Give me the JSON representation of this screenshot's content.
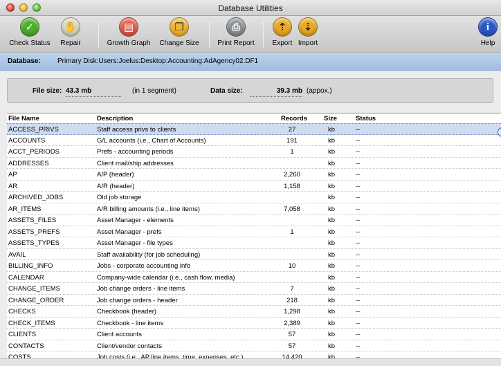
{
  "window": {
    "title": "Database Utilities"
  },
  "toolbar": {
    "buttons": [
      {
        "label": "Check Status",
        "icon": "check-icon",
        "color": "#4cae2a"
      },
      {
        "label": "Repair",
        "icon": "hand-icon",
        "color": "#c9c9b1"
      },
      {
        "label": "Growth Graph",
        "icon": "graph-icon",
        "color": "#e05a48"
      },
      {
        "label": "Change Size",
        "icon": "copy-pages-icon",
        "color": "#f0b52c"
      },
      {
        "label": "Print Report",
        "icon": "printer-icon",
        "color": "#8b9096"
      },
      {
        "label": "Export",
        "icon": "export-icon",
        "color": "#e8a820"
      },
      {
        "label": "Import",
        "icon": "import-icon",
        "color": "#e8a820"
      },
      {
        "label": "Help",
        "icon": "info-icon",
        "color": "#2a56c8"
      }
    ]
  },
  "database": {
    "label": "Database:",
    "path": "Primary Disk:Users:Joelus:Desktop:Accounting:AdAgency02.DF1"
  },
  "sizes": {
    "file_size_label": "File size:",
    "file_size_value": "43.3 mb",
    "segments": "(in 1 segment)",
    "data_size_label": "Data size:",
    "data_size_value": "39.3 mb",
    "approx": "(appox.)"
  },
  "table": {
    "headers": [
      "File Name",
      "Description",
      "Records",
      "Size",
      "Status"
    ],
    "selected_row": 0,
    "rows": [
      {
        "name": "ACCESS_PRIVS",
        "desc": "Staff access privs to clients",
        "records": "27",
        "size": "kb",
        "status": "--"
      },
      {
        "name": "ACCOUNTS",
        "desc": "G/L accounts (i.e., Chart of Accounts)",
        "records": "191",
        "size": "kb",
        "status": "--"
      },
      {
        "name": "ACCT_PERIODS",
        "desc": "Prefs - accounting periods",
        "records": "1",
        "size": "kb",
        "status": "--"
      },
      {
        "name": "ADDRESSES",
        "desc": "Client mail/ship addresses",
        "records": "",
        "size": "kb",
        "status": "--"
      },
      {
        "name": "AP",
        "desc": "A/P (header)",
        "records": "2,260",
        "size": "kb",
        "status": "--"
      },
      {
        "name": "AR",
        "desc": "A/R (header)",
        "records": "1,158",
        "size": "kb",
        "status": "--"
      },
      {
        "name": "ARCHIVED_JOBS",
        "desc": "Old job storage",
        "records": "",
        "size": "kb",
        "status": "--"
      },
      {
        "name": "AR_ITEMS",
        "desc": "A/R billing amounts (i.e., line items)",
        "records": "7,058",
        "size": "kb",
        "status": "--"
      },
      {
        "name": "ASSETS_FILES",
        "desc": "Asset Manager - elements",
        "records": "",
        "size": "kb",
        "status": "--"
      },
      {
        "name": "ASSETS_PREFS",
        "desc": "Asset Manager - prefs",
        "records": "1",
        "size": "kb",
        "status": "--"
      },
      {
        "name": "ASSETS_TYPES",
        "desc": "Asset Manager - file types",
        "records": "",
        "size": "kb",
        "status": "--"
      },
      {
        "name": "AVAIL",
        "desc": "Staff availability (for job scheduling)",
        "records": "",
        "size": "kb",
        "status": "--"
      },
      {
        "name": "BILLING_INFO",
        "desc": "Jobs - corporate accounting info",
        "records": "10",
        "size": "kb",
        "status": "--"
      },
      {
        "name": "CALENDAR",
        "desc": "Company-wide calendar (i.e., cash flow, media)",
        "records": "",
        "size": "kb",
        "status": "--"
      },
      {
        "name": "CHANGE_ITEMS",
        "desc": "Job change orders - line items",
        "records": "7",
        "size": "kb",
        "status": "--"
      },
      {
        "name": "CHANGE_ORDER",
        "desc": "Job change orders - header",
        "records": "218",
        "size": "kb",
        "status": "--"
      },
      {
        "name": "CHECKS",
        "desc": "Checkbook (header)",
        "records": "1,298",
        "size": "kb",
        "status": "--"
      },
      {
        "name": "CHECK_ITEMS",
        "desc": "Checkbook - line items",
        "records": "2,389",
        "size": "kb",
        "status": "--"
      },
      {
        "name": "CLIENTS",
        "desc": "Client accounts",
        "records": "57",
        "size": "kb",
        "status": "--"
      },
      {
        "name": "CONTACTS",
        "desc": "Client/vendor contacts",
        "records": "57",
        "size": "kb",
        "status": "--"
      },
      {
        "name": "COSTS",
        "desc": "Job costs (i.e., AP line items, time, expenses, etc.)",
        "records": "14,420",
        "size": "kb",
        "status": "--"
      }
    ]
  }
}
